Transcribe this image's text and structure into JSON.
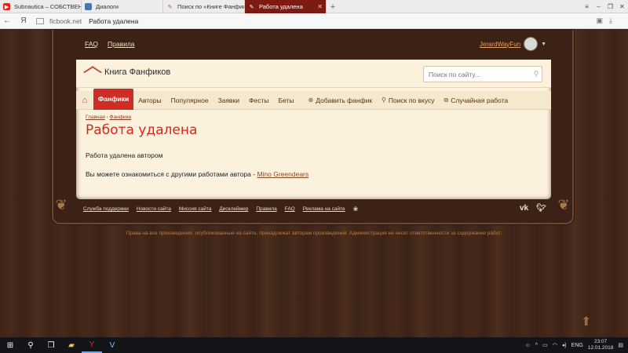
{
  "browser": {
    "tabs": [
      {
        "label": "Subnautica – СОБСТВЕННО",
        "favicon_color": "#e62117",
        "favicon": "youtube-icon",
        "active": false
      },
      {
        "label": "Диалоги",
        "favicon_color": "#4a76a8",
        "favicon": "vk-messages-icon",
        "active": false
      },
      {
        "label": "Поиск по «Книге Фанфиков»",
        "favicon_color": "#b7523c",
        "favicon": "feather-icon",
        "active": false
      },
      {
        "label": "Работа удалена",
        "favicon_color": "#b7523c",
        "favicon": "feather-icon",
        "active": true
      }
    ],
    "address": {
      "domain": "ficbook.net",
      "title": "Работа удалена"
    }
  },
  "site": {
    "userbar": {
      "faq": "FAQ",
      "rules": "Правила"
    },
    "user": {
      "name": "JerardWayFun"
    },
    "logo_text": "Книга Фанфиков",
    "search_placeholder": "Поиск по сайту...",
    "menu": {
      "fanfics": "Фанфики",
      "authors": "Авторы",
      "popular": "Популярное",
      "requests": "Заявки",
      "fests": "Фесты",
      "betas": "Беты",
      "add_fanfic": "Добавить фанфик",
      "search_taste": "Поиск по вкусу",
      "random": "Случайная работа"
    },
    "breadcrumbs": {
      "home": "Главная",
      "fanfics": "Фанфики"
    },
    "heading": "Работа удалена",
    "message": "Работа удалена автором",
    "other_works_text": "Вы можете ознакомиться с другими работами автора - ",
    "author_link": "Mino Greendears",
    "footer": {
      "support": "Служба поддержки",
      "news": "Новости сайта",
      "mission": "Миссия сайта",
      "disclaimer": "Дисклеймер",
      "rules": "Правила",
      "faq": "FAQ",
      "ads": "Реклама на сайте"
    },
    "copyright": "Права на все произведения, опубликованные на сайте, принадлежат авторам произведений. Администрация не несет ответственности за содержание работ."
  },
  "taskbar": {
    "lang": "ENG",
    "time": "23:07",
    "date": "12.01.2018"
  }
}
